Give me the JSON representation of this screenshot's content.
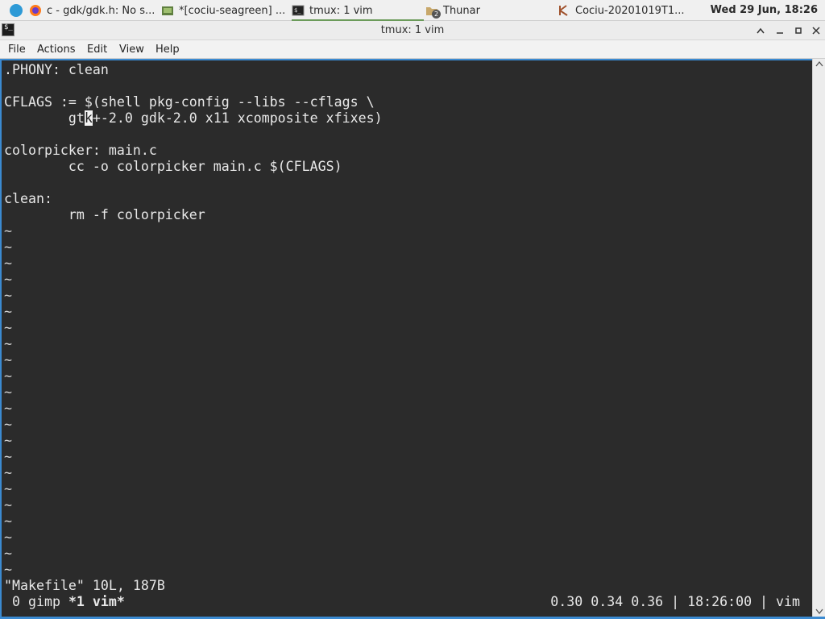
{
  "taskbar": {
    "tasks": [
      {
        "label": "c - gdk/gdk.h: No s...",
        "icon": "firefox-icon"
      },
      {
        "label": "*[cociu-seagreen] ...",
        "icon": "gimp-icon"
      },
      {
        "label": "tmux: 1 vim",
        "icon": "terminal-icon"
      },
      {
        "label": "Thunar",
        "icon": "folder-icon",
        "badge": "2"
      },
      {
        "label": "Cociu-20201019T1...",
        "icon": "image-viewer-icon"
      }
    ],
    "clock": "Wed 29 Jun, 18:26"
  },
  "window": {
    "title": "tmux: 1 vim",
    "menu": [
      "File",
      "Actions",
      "Edit",
      "View",
      "Help"
    ]
  },
  "editor": {
    "lines": [
      ".PHONY: clean",
      "",
      "CFLAGS := $(shell pkg-config --libs --cflags \\",
      "        gtk+-2.0 gdk-2.0 x11 xcomposite xfixes)",
      "",
      "colorpicker: main.c",
      "        cc -o colorpicker main.c $(CFLAGS)",
      "",
      "clean:",
      "        rm -f colorpicker"
    ],
    "cursor_line_parts": [
      "        gt",
      "k",
      "+-2.0 gdk-2.0 x11 xcomposite xfixes)"
    ],
    "tilde": "~",
    "vim_message": "\"Makefile\" 10L, 187B"
  },
  "tmux": {
    "windows_left": " 0 gimp ",
    "active_window": "*1 vim*",
    "status_right": "0.30 0.34 0.36 | 18:26:00 | vim"
  },
  "colors": {
    "terminal_bg": "#2b2b2b",
    "accent": "#3b8ad1"
  }
}
